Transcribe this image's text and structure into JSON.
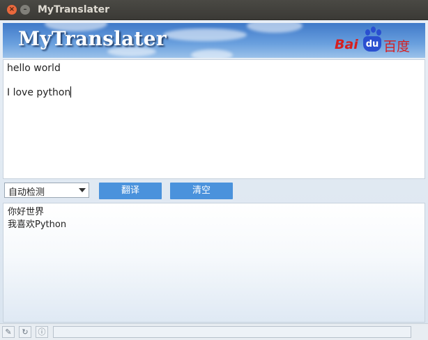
{
  "window": {
    "title": "MyTranslater",
    "close_glyph": "×",
    "minimize_glyph": "–"
  },
  "banner": {
    "title": "MyTranslater",
    "logo": {
      "bai": "Bai",
      "du": "du",
      "cn": "百度"
    }
  },
  "input": {
    "lines": [
      "hello world",
      "",
      "I love python"
    ]
  },
  "controls": {
    "language_select": {
      "selected": "自动检测"
    },
    "translate_label": "翻译",
    "clear_label": "清空"
  },
  "output": {
    "lines": [
      "你好世界",
      "我喜欢Python"
    ]
  },
  "statusbar": {
    "pin_glyph": "✎",
    "refresh_glyph": "↻",
    "info_glyph": "ⓘ",
    "text": ""
  },
  "colors": {
    "button_bg": "#4a92dc",
    "titlebar_bg": "#3b3a36",
    "close_button": "#e9683c",
    "baidu_red": "#d51f20",
    "baidu_blue": "#2a4fd0"
  }
}
